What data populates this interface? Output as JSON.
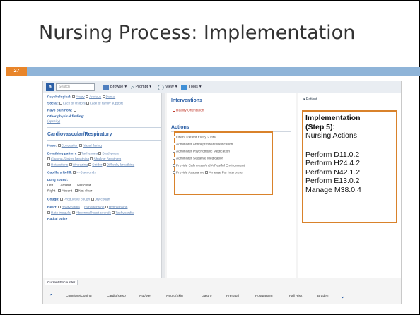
{
  "slide": {
    "title": "Nursing Process: Implementation",
    "number": "27"
  },
  "toolbar": {
    "search_placeholder": "Search",
    "browse_label": "Browse",
    "prompt_label": "Prompt",
    "view_label": "View",
    "tools_label": "Tools"
  },
  "left": {
    "psych_label": "Psychological:",
    "psych_opts": [
      "Angry",
      "Anxious",
      "Denial"
    ],
    "social_label": "Social:",
    "social_opts": [
      "Lack of visitors",
      "Lack of family support"
    ],
    "pain_label": "Have pain now:",
    "other_label": "Other physical finding:",
    "other_link": "(specify)",
    "section_title": "Cardiovascular/Respiratory",
    "nose_label": "Nose:",
    "nose_opts": [
      "Congestion",
      "Nasal flaring"
    ],
    "breathing_label": "Breathing pattern:",
    "breathing_opts_1": [
      "Tachypnea",
      "Bradypnea"
    ],
    "breathing_opts_2": [
      "Cheyne-Stokes breathing",
      "Shallow Breathing"
    ],
    "breathing_opts_3": [
      "Retractions",
      "Wheezing",
      "Stridor",
      "Difficulty breathing"
    ],
    "cap_label": "Capillary Refill:",
    "cap_opt": ">=3 seconds",
    "lung_label": "Lung sound:",
    "lung_left": "Left",
    "lung_right": "Right",
    "lung_absent": "Absent",
    "lung_notclear": "Not clear",
    "cough_label": "Cough:",
    "cough_opts": [
      "Productive cough",
      "Dry cough"
    ],
    "heart_label": "Heart:",
    "heart_opts_1": [
      "Bradycardia",
      "Hypertension",
      "Hypotension"
    ],
    "heart_opts_2": [
      "Rate irregular",
      "Abnormal heart sounds",
      "Tachycardia"
    ],
    "bottom_cut": "Radial pulse"
  },
  "middle": {
    "interventions_title": "Interventions",
    "interventions_item": "Reality Orientation",
    "actions_title": "Actions",
    "actions": [
      "Orient Patient Every 2 Hrs",
      "Administer Antidepressant Medication",
      "Administer Psychotropic Medication",
      "Administer Sedative Medication",
      "Provide Calmness And A Restful Environment",
      "Provide Assurance"
    ],
    "actions_extra": "Arrange For Interpreter"
  },
  "right": {
    "patient_label": "Patient",
    "impl_title": "Implementation",
    "impl_step": "(Step 5):",
    "impl_sub": "Nursing Actions",
    "perform_lines": [
      "Perform D11.0.2",
      "Perform H24.4.2",
      "Perform N42.1.2",
      "Perform E13.0.2",
      "Manage M38.0.4"
    ]
  },
  "footer": {
    "encounter_tab": "Current Encounter",
    "nav_items": [
      "Cognitive/Coping",
      "Cardio/Resp",
      "Nut/Met",
      "Neuro/Skin",
      "Gastro",
      "Prenatal",
      "Postpartum",
      "Fall Risk",
      "Braden"
    ]
  },
  "colors": {
    "accent_orange": "#d9822b",
    "bar_blue": "#8fb4d8",
    "link_blue": "#2c5fa5"
  }
}
